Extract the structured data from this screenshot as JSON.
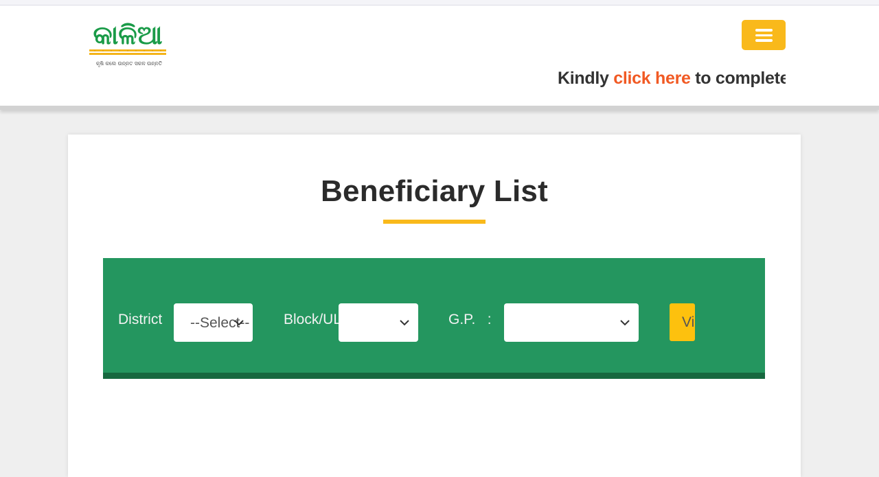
{
  "header": {
    "logo_text": "କାଳିଆ",
    "logo_tagline": "କୃଷି କଲେ ଉନ୍ନତ ସକଳ ଉନ୍ନତି",
    "logo_colors": {
      "text": "#1a9b48",
      "wheat": "#f4b41a"
    },
    "menu_icon": "hamburger-icon",
    "marquee": {
      "prefix": "Kindly ",
      "link": "click here",
      "suffix": " to complete your"
    }
  },
  "page": {
    "title": "Beneficiary List"
  },
  "filters": {
    "district_label": "District",
    "district_value": "--Select--",
    "block_label": "Block/ULB",
    "block_value": "",
    "gp_label": "G.P.   :",
    "gp_value": "",
    "view_button": "View"
  },
  "colors": {
    "accent": "#f9b91b",
    "filter_bg": "#24965f",
    "filter_border": "#17683f",
    "link": "#f15a24"
  }
}
